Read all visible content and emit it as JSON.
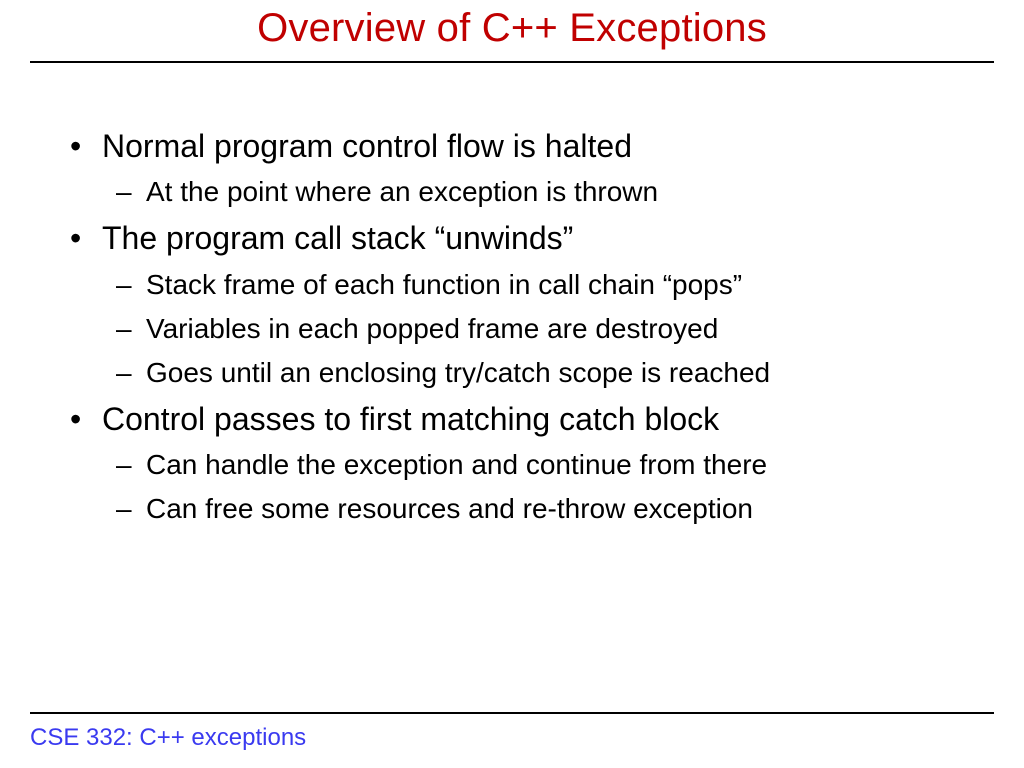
{
  "title": "Overview of C++ Exceptions",
  "bullets": [
    {
      "text": "Normal program control flow is halted",
      "sub": [
        "At the point where an exception is thrown"
      ]
    },
    {
      "text": "The program call stack “unwinds”",
      "sub": [
        "Stack frame of each function in call chain “pops”",
        "Variables in each popped frame are destroyed",
        "Goes until an enclosing try/catch scope is reached"
      ]
    },
    {
      "text": "Control passes to first matching catch block",
      "sub": [
        "Can handle the exception and continue from there",
        "Can free some resources and re-throw exception"
      ]
    }
  ],
  "footer": "CSE 332: C++ exceptions"
}
